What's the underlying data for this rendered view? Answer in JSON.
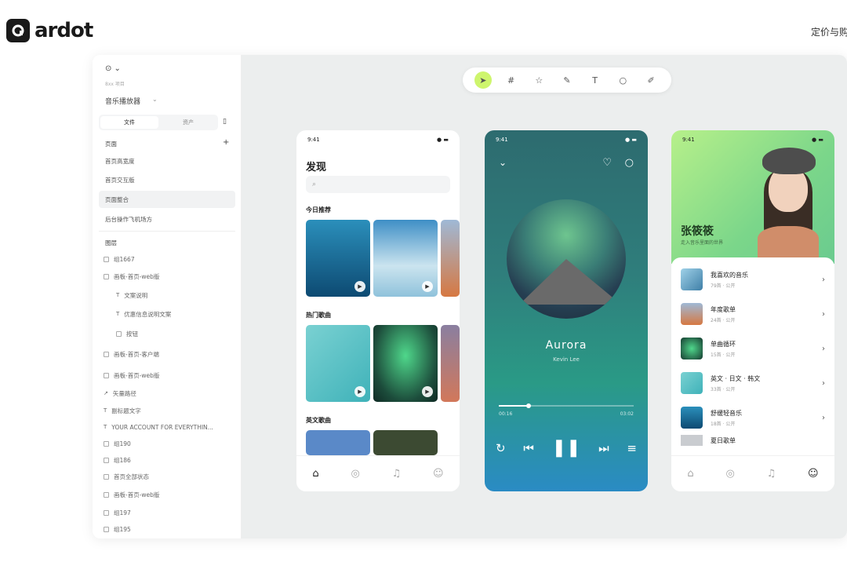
{
  "brand": {
    "name": "ardot"
  },
  "header": {
    "pricing": "定价与购买"
  },
  "sidebar": {
    "project_sub": "8xx 项目",
    "file_name": "音乐播放器",
    "tab_files": "文件",
    "tab_assets": "资产",
    "pages_label": "页面",
    "pages": [
      "首页高宽度",
      "首页交互版",
      "页面整合",
      "后台操作飞机场方"
    ],
    "layers_label": "图层",
    "layers": [
      "组1667",
      "画板-首页-web版",
      "文案说明",
      "优惠信息说明文案",
      "按钮",
      "画板-首页-客户端",
      "画板-首页-web版",
      "矢量路径",
      "副标题文字",
      "YOUR ACCOUNT FOR EVERYTHIN...",
      "组190",
      "组186",
      "首页全部状态",
      "画板-首页-web版",
      "组197",
      "组195"
    ]
  },
  "toolbar": {
    "icons": [
      "select",
      "frame",
      "star",
      "pen",
      "T",
      "comment",
      "brush"
    ]
  },
  "phone1": {
    "time": "9:41",
    "status": "● ▬",
    "title": "发现",
    "search_placeholder": "",
    "section1": "今日推荐",
    "section2": "热门歌曲",
    "section3": "英文歌曲"
  },
  "phone2": {
    "time": "9:41",
    "status": "● ▬",
    "song": "Aurora",
    "artist": "Kevin Lee",
    "t_start": "00:16",
    "t_end": "03:02",
    "progress": 0.22
  },
  "phone3": {
    "time": "9:41",
    "status": "● ▬",
    "name": "张筱筱",
    "sub": "走入音乐里面的世界",
    "items": [
      {
        "title": "我喜欢的音乐",
        "meta": "79首 · 公开"
      },
      {
        "title": "年度歌单",
        "meta": "24首 · 公开"
      },
      {
        "title": "单曲循环",
        "meta": "15首 · 公开"
      },
      {
        "title": "英文 · 日文 · 韩文",
        "meta": "33首 · 公开"
      },
      {
        "title": "舒缓轻音乐",
        "meta": "18首 · 公开"
      },
      {
        "title": "夏日歌单",
        "meta": ""
      }
    ]
  },
  "colors": {
    "accent": "#cef56d"
  }
}
